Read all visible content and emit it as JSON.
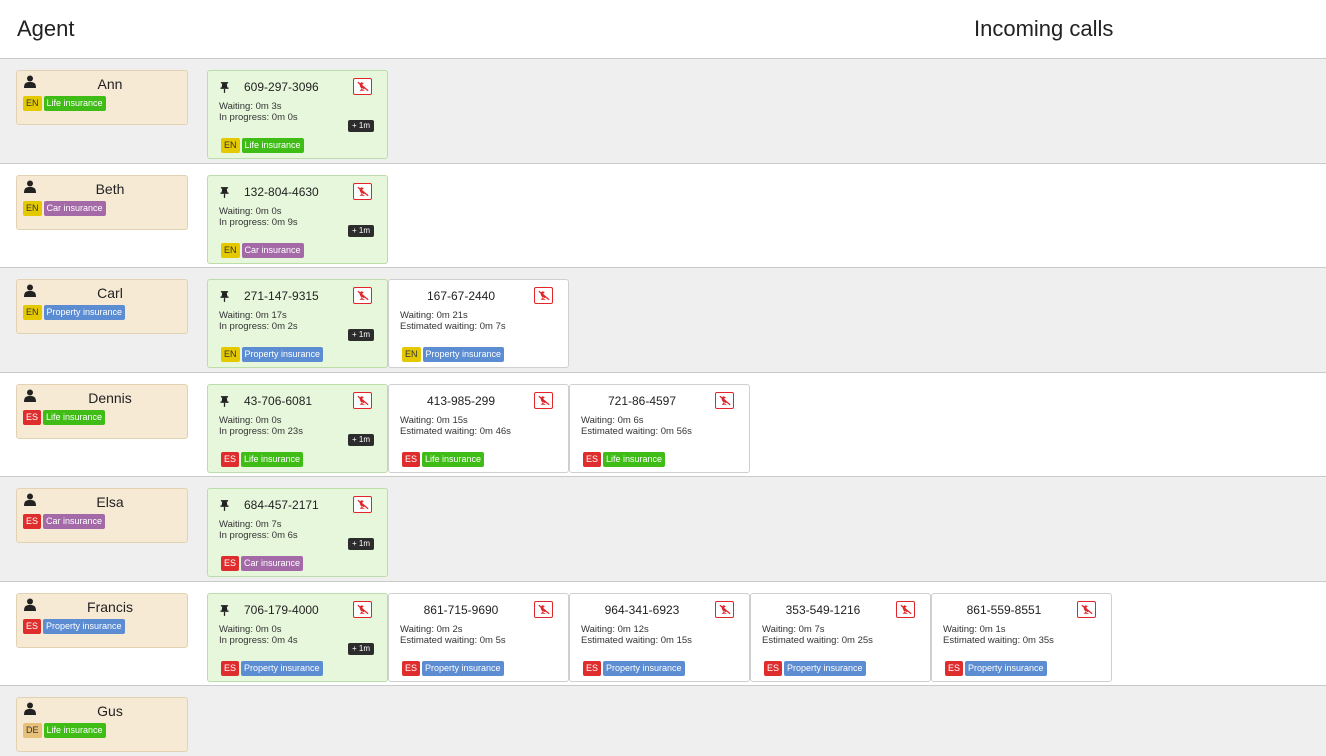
{
  "header": {
    "agent_title": "Agent",
    "calls_title": "Incoming calls"
  },
  "icons": {
    "agent": "person-icon",
    "pin": "pushpin-icon",
    "hangup": "hangup-phone-icon"
  },
  "colors": {
    "agent_card": "#f6ead5",
    "active_call": "#e7f7dc",
    "hangup": "#e0262b",
    "row_shade": "#efefef"
  },
  "rows": [
    {
      "agent": {
        "name": "Ann",
        "lang": "EN",
        "category": "Life insurance"
      },
      "active_call": {
        "number": "609-297-3096",
        "waiting": "Waiting: 0m 3s",
        "progress": "In progress: 0m 0s",
        "extend": "+ 1m",
        "lang": "EN",
        "category": "Life insurance"
      },
      "queued": []
    },
    {
      "agent": {
        "name": "Beth",
        "lang": "EN",
        "category": "Car insurance"
      },
      "active_call": {
        "number": "132-804-4630",
        "waiting": "Waiting: 0m 0s",
        "progress": "In progress: 0m 9s",
        "extend": "+ 1m",
        "lang": "EN",
        "category": "Car insurance"
      },
      "queued": []
    },
    {
      "agent": {
        "name": "Carl",
        "lang": "EN",
        "category": "Property insurance"
      },
      "active_call": {
        "number": "271-147-9315",
        "waiting": "Waiting: 0m 17s",
        "progress": "In progress: 0m 2s",
        "extend": "+ 1m",
        "lang": "EN",
        "category": "Property insurance"
      },
      "queued": [
        {
          "number": "167-67-2440",
          "waiting": "Waiting: 0m 21s",
          "estimated": "Estimated waiting: 0m 7s",
          "lang": "EN",
          "category": "Property insurance"
        }
      ]
    },
    {
      "agent": {
        "name": "Dennis",
        "lang": "ES",
        "category": "Life insurance"
      },
      "active_call": {
        "number": "43-706-6081",
        "waiting": "Waiting: 0m 0s",
        "progress": "In progress: 0m 23s",
        "extend": "+ 1m",
        "lang": "ES",
        "category": "Life insurance"
      },
      "queued": [
        {
          "number": "413-985-299",
          "waiting": "Waiting: 0m 15s",
          "estimated": "Estimated waiting: 0m 46s",
          "lang": "ES",
          "category": "Life insurance"
        },
        {
          "number": "721-86-4597",
          "waiting": "Waiting: 0m 6s",
          "estimated": "Estimated waiting: 0m 56s",
          "lang": "ES",
          "category": "Life insurance"
        }
      ]
    },
    {
      "agent": {
        "name": "Elsa",
        "lang": "ES",
        "category": "Car insurance"
      },
      "active_call": {
        "number": "684-457-2171",
        "waiting": "Waiting: 0m 7s",
        "progress": "In progress: 0m 6s",
        "extend": "+ 1m",
        "lang": "ES",
        "category": "Car insurance"
      },
      "queued": []
    },
    {
      "agent": {
        "name": "Francis",
        "lang": "ES",
        "category": "Property insurance"
      },
      "active_call": {
        "number": "706-179-4000",
        "waiting": "Waiting: 0m 0s",
        "progress": "In progress: 0m 4s",
        "extend": "+ 1m",
        "lang": "ES",
        "category": "Property insurance"
      },
      "queued": [
        {
          "number": "861-715-9690",
          "waiting": "Waiting: 0m 2s",
          "estimated": "Estimated waiting: 0m 5s",
          "lang": "ES",
          "category": "Property insurance"
        },
        {
          "number": "964-341-6923",
          "waiting": "Waiting: 0m 12s",
          "estimated": "Estimated waiting: 0m 15s",
          "lang": "ES",
          "category": "Property insurance"
        },
        {
          "number": "353-549-1216",
          "waiting": "Waiting: 0m 7s",
          "estimated": "Estimated waiting: 0m 25s",
          "lang": "ES",
          "category": "Property insurance"
        },
        {
          "number": "861-559-8551",
          "waiting": "Waiting: 0m 1s",
          "estimated": "Estimated waiting: 0m 35s",
          "lang": "ES",
          "category": "Property insurance"
        }
      ]
    },
    {
      "agent": {
        "name": "Gus",
        "lang": "DE",
        "category": "Life insurance"
      },
      "active_call": null,
      "queued": []
    }
  ]
}
